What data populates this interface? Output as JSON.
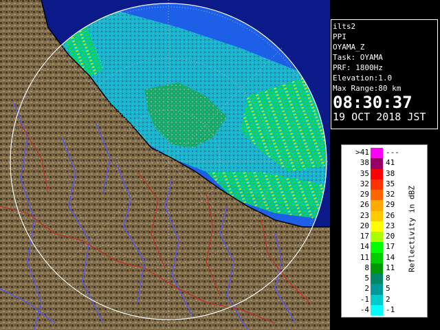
{
  "info": {
    "station": "ilts2",
    "product": "PPI",
    "field": "OYAMA_Z",
    "task": "Task: OYAMA",
    "prf": "PRF: 1800Hz",
    "elevation": "Elevation:1.0",
    "max_range": "Max Range:80 km",
    "time": "08:30:37",
    "date": "19 OCT 2018 JST"
  },
  "legend": {
    "title": "Reflectivity in dBZ",
    "rows": [
      {
        "lo": ">41",
        "hi": "---",
        "color": "#ff00ff"
      },
      {
        "lo": "38",
        "hi": "41",
        "color": "#990066"
      },
      {
        "lo": "35",
        "hi": "38",
        "color": "#ff0000"
      },
      {
        "lo": "32",
        "hi": "35",
        "color": "#ff3300"
      },
      {
        "lo": "29",
        "hi": "32",
        "color": "#ff6600"
      },
      {
        "lo": "26",
        "hi": "29",
        "color": "#ffaa00"
      },
      {
        "lo": "23",
        "hi": "26",
        "color": "#ffcc00"
      },
      {
        "lo": "20",
        "hi": "23",
        "color": "#ffff00"
      },
      {
        "lo": "17",
        "hi": "20",
        "color": "#aaff00"
      },
      {
        "lo": "14",
        "hi": "17",
        "color": "#00ff00"
      },
      {
        "lo": "11",
        "hi": "14",
        "color": "#00cc00"
      },
      {
        "lo": "8",
        "hi": "11",
        "color": "#009900"
      },
      {
        "lo": "5",
        "hi": "8",
        "color": "#008866"
      },
      {
        "lo": "2",
        "hi": "5",
        "color": "#009999"
      },
      {
        "lo": "-1",
        "hi": "2",
        "color": "#00cccc"
      },
      {
        "lo": "-4",
        "hi": "-1",
        "color": "#00ffff"
      }
    ]
  },
  "colors": {
    "sea": "#1e5fe8",
    "outside": "#0a1a88",
    "land": "#7a6a4a",
    "river": "#5555ff",
    "border": "#cc2222"
  }
}
